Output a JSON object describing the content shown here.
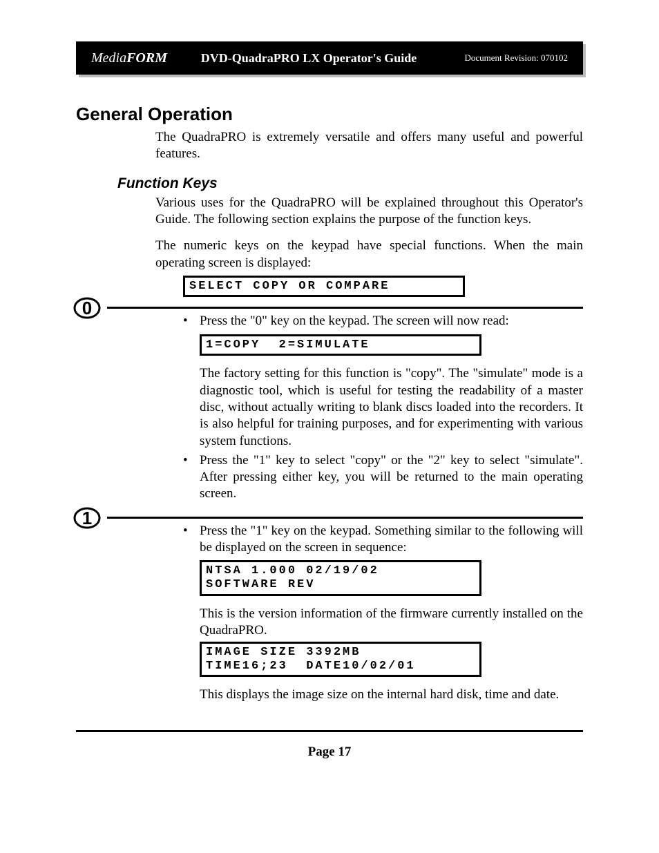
{
  "header": {
    "logo1": "Media",
    "logo2": "FORM",
    "title": "DVD-QuadraPRO LX Operator's Guide",
    "revision": "Document Revision: 070102"
  },
  "section_title": "General Operation",
  "intro_text": "The QuadraPRO is extremely versatile and offers many useful and powerful features.",
  "sub_title": "Function Keys",
  "fk_p1": "Various uses for the QuadraPRO will be explained throughout this Operator's Guide. The following section explains the purpose of the function keys.",
  "fk_p2": "The numeric keys on the keypad have special functions. When the main operating screen is displayed:",
  "lcd1": "SELECT COPY OR COMPARE",
  "step0": {
    "label": "0",
    "b1": "Press the \"0\" key on the keypad. The screen will now read:",
    "lcd": "1=COPY  2=SIMULATE",
    "b2": "The factory setting for this function is \"copy\". The \"simulate\" mode is a diagnostic tool, which is useful for testing the readability of a master disc, without actually writing to blank discs loaded into the recorders. It is also helpful for training purposes, and for experimenting with various system functions.",
    "b3": "Press the \"1\" key to select \"copy\" or the \"2\" key to select \"simulate\". After pressing either key, you will be returned to the main operating screen."
  },
  "step1": {
    "label": "1",
    "b1": "Press the \"1\" key on the keypad. Something similar to the following will be displayed on the screen in sequence:",
    "lcd1": "NTSA 1.000 02/19/02\nSOFTWARE REV",
    "p1": "This is the version information of the firmware currently installed on the QuadraPRO.",
    "lcd2": "IMAGE SIZE 3392MB\nTIME16;23  DATE10/02/01",
    "p2": "This displays the image size on the internal hard disk, time and date."
  },
  "footer": "Page 17"
}
